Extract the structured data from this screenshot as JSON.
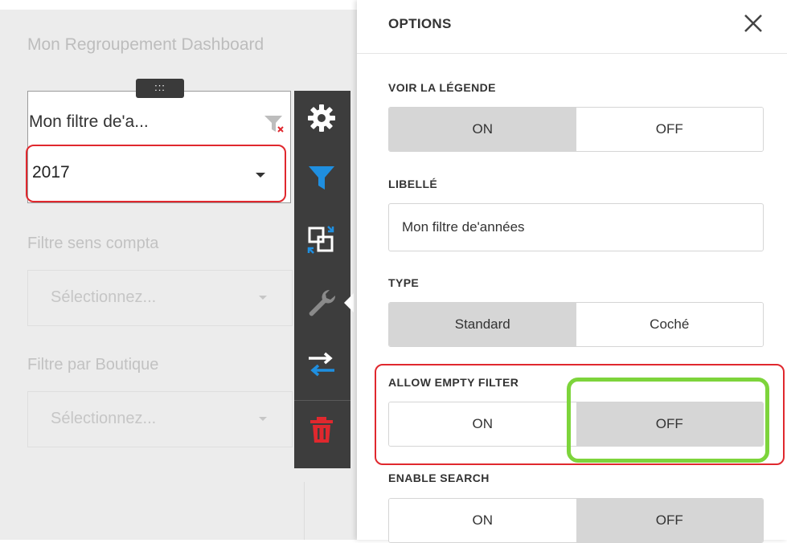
{
  "dashboard": {
    "title": "Mon Regroupement Dashboard",
    "drag_handle": ":::",
    "year_filter": {
      "title": "Mon filtre de'a...",
      "value": "2017"
    },
    "filters": [
      {
        "label": "Filtre sens compta",
        "placeholder": "Sélectionnez..."
      },
      {
        "label": "Filtre par Boutique",
        "placeholder": "Sélectionnez..."
      }
    ]
  },
  "toolbar": {
    "tools": [
      {
        "icon": "gear-icon",
        "color": "#ffffff"
      },
      {
        "icon": "filter-icon",
        "color": "#1f8fe0"
      },
      {
        "icon": "convert-icon",
        "color": "#ffffff"
      },
      {
        "icon": "wrench-icon",
        "color": "#8a8a8a"
      },
      {
        "icon": "swap-icon",
        "color": "#ffffff"
      },
      {
        "icon": "trash-icon",
        "color": "#e0282e"
      }
    ]
  },
  "options": {
    "title": "OPTIONS",
    "show_legend": {
      "label": "VOIR LA LÉGENDE",
      "on": "ON",
      "off": "OFF",
      "selected": "ON"
    },
    "caption": {
      "label": "LIBELLÉ",
      "value": "Mon filtre de'années"
    },
    "type": {
      "label": "TYPE",
      "standard": "Standard",
      "checked": "Coché",
      "selected": "Standard"
    },
    "allow_empty": {
      "label": "ALLOW EMPTY FILTER",
      "on": "ON",
      "off": "OFF",
      "selected": "OFF"
    },
    "enable_search": {
      "label": "ENABLE SEARCH",
      "on": "ON",
      "off": "OFF",
      "selected": "OFF"
    }
  },
  "colors": {
    "highlight_red": "#e0282e",
    "highlight_green": "#7dd43b",
    "active_segment": "#d6d6d6"
  }
}
